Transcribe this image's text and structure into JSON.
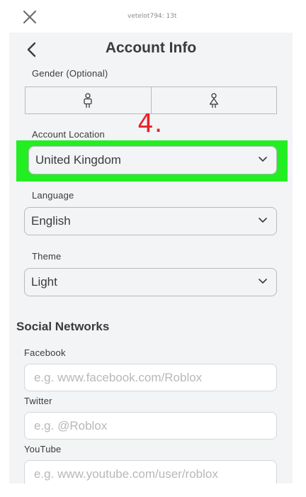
{
  "topbar": {
    "username": "vetelot794: 13t"
  },
  "header": {
    "title": "Account Info"
  },
  "gender": {
    "label": "Gender (Optional)",
    "options": [
      "male-icon",
      "female-icon"
    ]
  },
  "annotation": {
    "text": "4.",
    "color": "#e8222a",
    "highlight_color": "#22ee22"
  },
  "account_location": {
    "label": "Account Location",
    "value": "United Kingdom"
  },
  "language": {
    "label": "Language",
    "value": "English"
  },
  "theme": {
    "label": "Theme",
    "value": "Light"
  },
  "social": {
    "heading": "Social Networks",
    "facebook": {
      "label": "Facebook",
      "placeholder": "e.g. www.facebook.com/Roblox"
    },
    "twitter": {
      "label": "Twitter",
      "placeholder": "e.g. @Roblox"
    },
    "youtube": {
      "label": "YouTube",
      "placeholder": "e.g. www.youtube.com/user/roblox"
    }
  }
}
